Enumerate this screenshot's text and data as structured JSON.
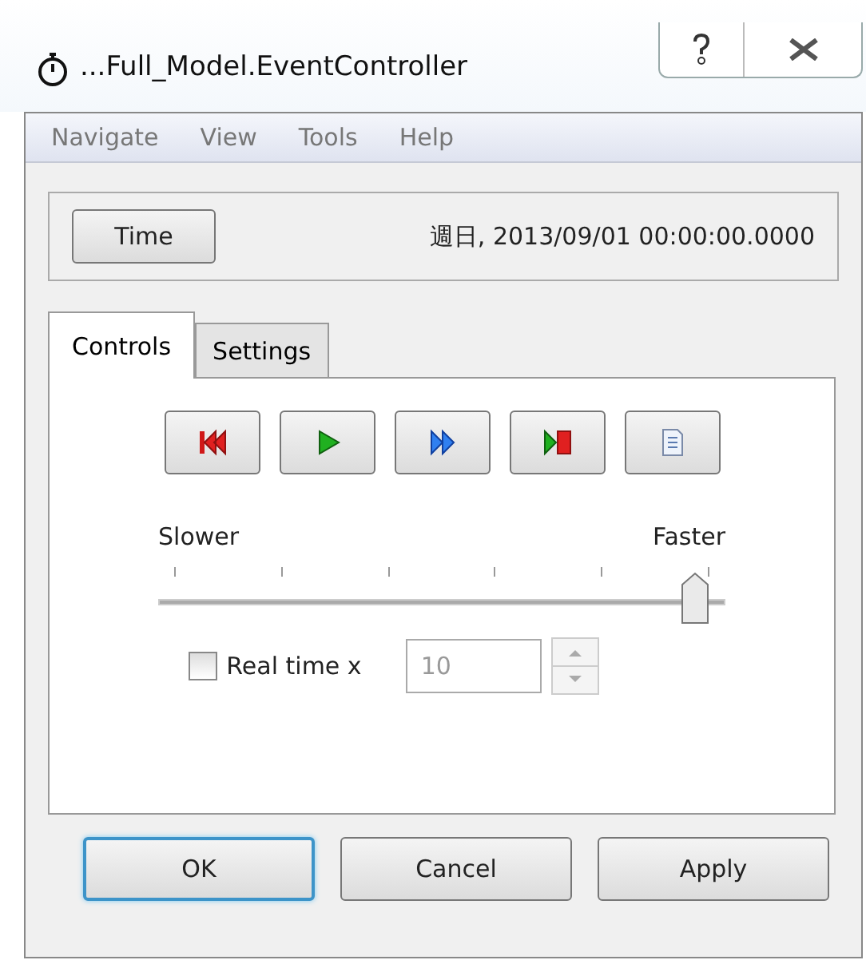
{
  "window": {
    "title": "...Full_Model.EventController"
  },
  "menu": [
    "Navigate",
    "View",
    "Tools",
    "Help"
  ],
  "time": {
    "button": "Time",
    "value": "週日, 2013/09/01 00:00:00.0000"
  },
  "tabs": [
    {
      "label": "Controls",
      "selected": true
    },
    {
      "label": "Settings",
      "selected": false
    }
  ],
  "media_buttons": [
    {
      "kind": "rewind"
    },
    {
      "kind": "play"
    },
    {
      "kind": "fastforward"
    },
    {
      "kind": "stop"
    },
    {
      "kind": "document"
    }
  ],
  "speed": {
    "min_label": "Slower",
    "max_label": "Faster",
    "level": 1
  },
  "real_time": {
    "label": "Real time x",
    "checked": false,
    "value": "10",
    "disabled": true
  },
  "buttons": [
    {
      "label": "OK",
      "default": true
    },
    {
      "label": "Cancel",
      "default": false
    },
    {
      "label": "Apply",
      "default": false
    }
  ]
}
